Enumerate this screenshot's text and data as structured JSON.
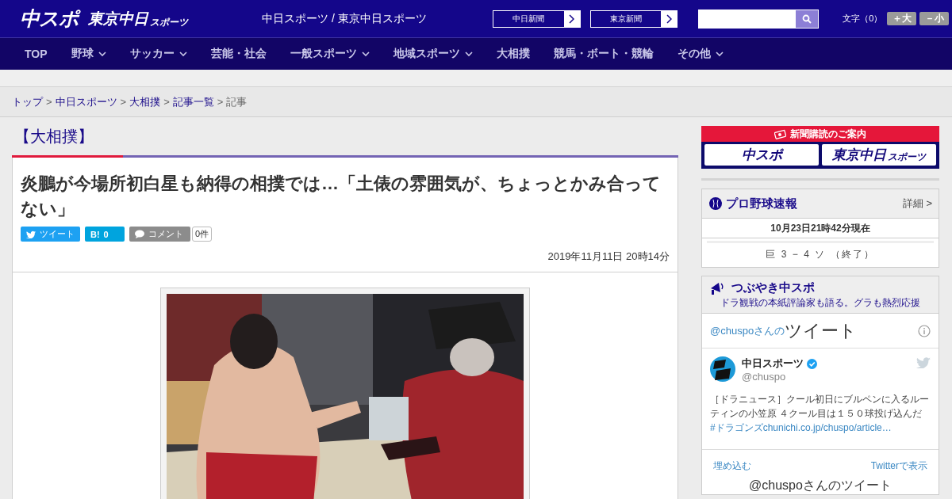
{
  "header": {
    "logo": {
      "main": "中スポ"
    },
    "logo2": {
      "main": "東京中日",
      "small": "スポーツ"
    },
    "site_names": "中日スポーツ / 東京中日スポーツ",
    "paper_links": [
      "中日新聞",
      "東京新聞"
    ],
    "font_size": {
      "label": "文字（0）",
      "buttons": [
        "＋大",
        "－小"
      ]
    }
  },
  "nav": [
    {
      "label": "TOP",
      "has_menu": false
    },
    {
      "label": "野球",
      "has_menu": true
    },
    {
      "label": "サッカー",
      "has_menu": true
    },
    {
      "label": "芸能・社会",
      "has_menu": false
    },
    {
      "label": "一般スポーツ",
      "has_menu": true
    },
    {
      "label": "地域スポーツ",
      "has_menu": true
    },
    {
      "label": "大相撲",
      "has_menu": false
    },
    {
      "label": "競馬・ボート・競輪",
      "has_menu": false
    },
    {
      "label": "その他",
      "has_menu": true
    }
  ],
  "breadcrumb": {
    "separator": ">",
    "items": [
      {
        "label": "トップ",
        "link": true
      },
      {
        "label": "中日スポーツ",
        "link": true
      },
      {
        "label": "大相撲",
        "link": true
      },
      {
        "label": "記事一覧",
        "link": true
      },
      {
        "label": "記事",
        "link": false
      }
    ]
  },
  "article": {
    "category": "【大相撲】",
    "title": "炎鵬が今場所初白星も納得の相撲では…「土俵の雰囲気が、ちょっとかみ合ってない」",
    "share": {
      "tweet": "ツイート",
      "hatena": "B!",
      "hatena_count": "0",
      "comment": "コメント",
      "comment_count": "0件"
    },
    "date": "2019年11月11日 20時14分"
  },
  "sidebar": {
    "subscribe": {
      "title": "新聞購読のご案内",
      "logos": [
        {
          "main": "中スポ"
        },
        {
          "main": "東京中日",
          "small": "スポーツ"
        }
      ]
    },
    "baseball": {
      "title": "プロ野球速報",
      "more": "詳細 >",
      "updated": "10月23日21時42分現在",
      "games": [
        "巨 3 − 4 ソ （終了）"
      ]
    },
    "twitter": {
      "title": "つぶやき中スポ",
      "subtitle": "ドラ観戦の本紙評論家も語る。グラも熱烈応援",
      "handle_prefix": "@chuspoさんの",
      "heading": "ツイート",
      "tweet": {
        "name": "中日スポーツ",
        "verified": true,
        "handle": "@chuspo",
        "text": "［ドラニュース］クール初日にブルペンに入るルーティンの小笠原 ４クール目は１５０球投げ込んだ",
        "link": "#ドラゴンズchunichi.co.jp/chuspo/article…"
      },
      "footer": [
        "埋め込む",
        "Twitterで表示"
      ],
      "next": "@chuspoさんのツイート"
    }
  }
}
